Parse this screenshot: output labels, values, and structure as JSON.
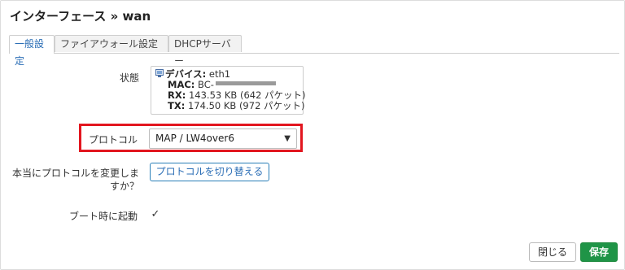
{
  "dialog": {
    "title": "インターフェース » wan"
  },
  "tabs": [
    {
      "label": "一般設定",
      "active": true
    },
    {
      "label": "ファイアウォール設定",
      "active": false
    },
    {
      "label": "DHCPサーバー",
      "active": false
    }
  ],
  "status": {
    "label": "状態",
    "device_key": "デバイス:",
    "device_value": "eth1",
    "mac_key": "MAC:",
    "mac_value": "BC-",
    "rx_key": "RX:",
    "rx_value": "143.53 KB (642 パケット)",
    "tx_key": "TX:",
    "tx_value": "174.50 KB (972 パケット)",
    "icon": "network-device-icon"
  },
  "protocol": {
    "label": "プロトコル",
    "selected": "MAP / LW4over6",
    "highlight_color": "#e2161f"
  },
  "switch_protocol": {
    "label": "本当にプロトコルを変更しますか？",
    "button_label": "プロトコルを切り替える"
  },
  "boot": {
    "label": "ブート時に起動",
    "checked": true,
    "check_glyph": "✓"
  },
  "footer": {
    "close_label": "閉じる",
    "save_label": "保存",
    "save_color": "#1f9447"
  }
}
